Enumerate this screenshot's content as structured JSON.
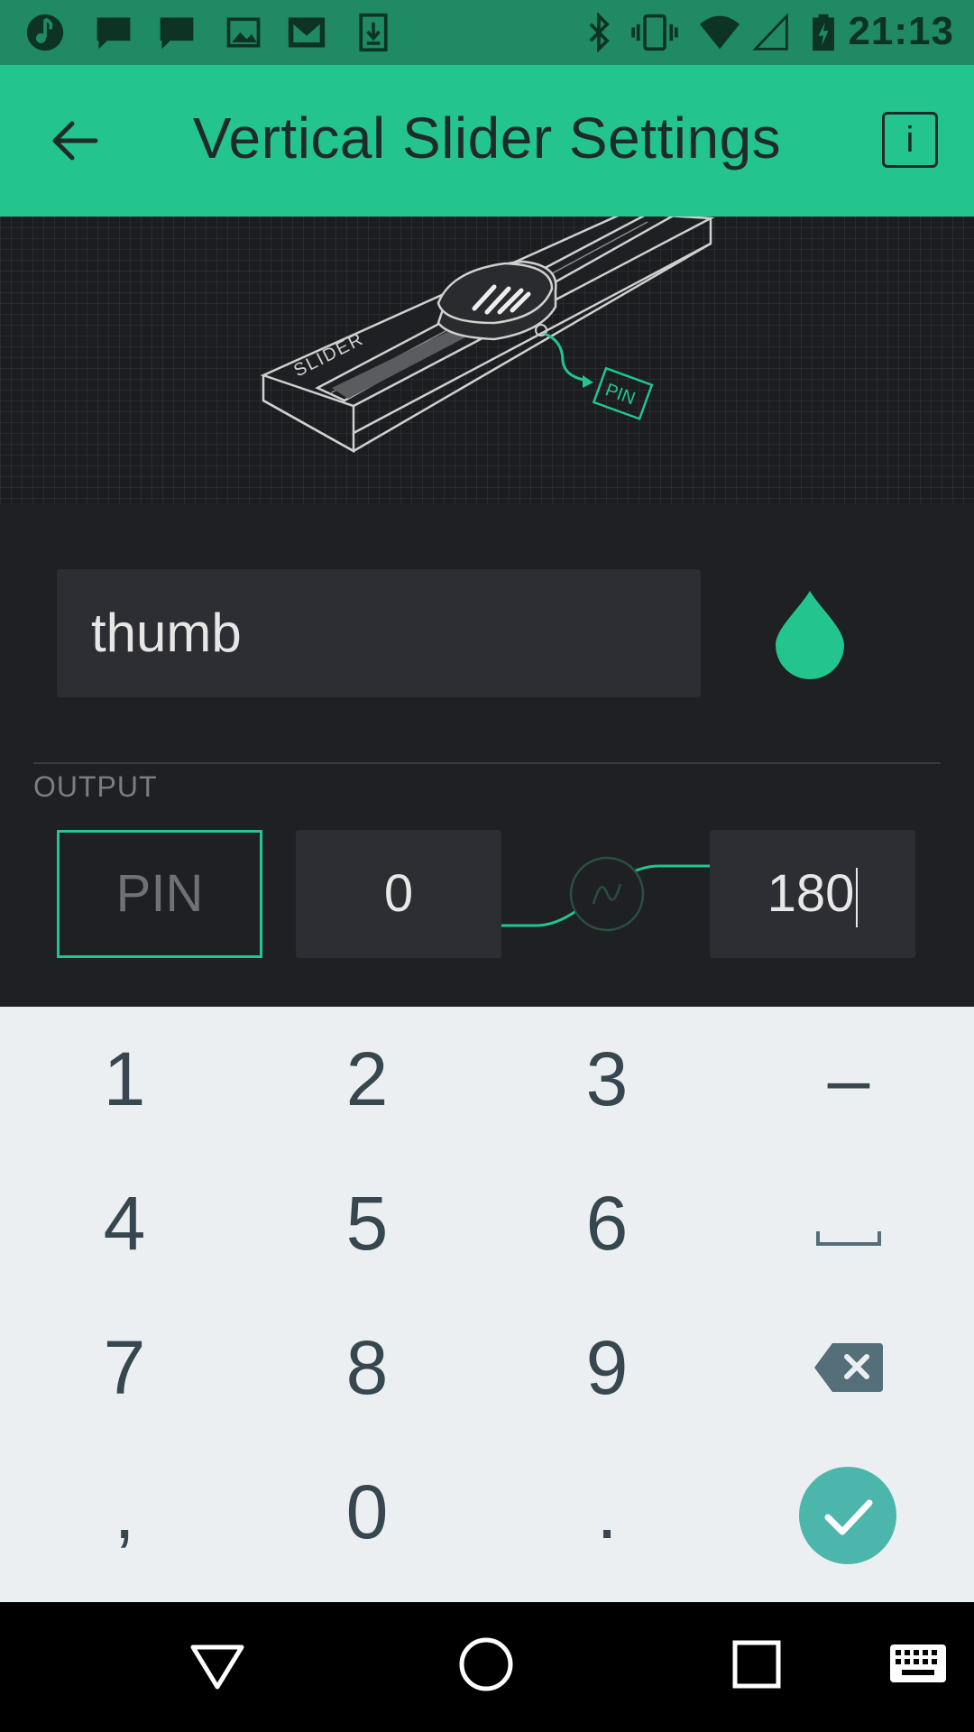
{
  "status_bar": {
    "time": "21:13",
    "left_icons": [
      "app-notification-icon",
      "chat-icon",
      "chat-icon",
      "image-icon",
      "gmail-icon",
      "download-icon"
    ],
    "right_icons": [
      "bluetooth-icon",
      "vibrate-icon",
      "wifi-icon",
      "cell-signal-icon",
      "battery-charging-icon"
    ]
  },
  "app_bar": {
    "title": "Vertical Slider Settings",
    "back_icon": "arrow-left-icon",
    "info_label": "i"
  },
  "illustration": {
    "slider_label": "SLIDER",
    "pin_label": "PIN"
  },
  "form": {
    "name_value": "thumb",
    "color": "#23c48e",
    "output_label": "OUTPUT",
    "pin_label": "PIN",
    "min_value": "0",
    "max_value": "180"
  },
  "keyboard": {
    "rows": [
      [
        "1",
        "2",
        "3",
        "–"
      ],
      [
        "4",
        "5",
        "6",
        "space"
      ],
      [
        "7",
        "8",
        "9",
        "backspace"
      ],
      [
        ",",
        "0",
        ".",
        "enter"
      ]
    ],
    "enter_color": "#4db6ac"
  },
  "nav_bar": {
    "buttons": [
      "back-triangle-icon",
      "home-circle-icon",
      "recents-square-icon",
      "keyboard-icon"
    ]
  },
  "colors": {
    "accent": "#23c48e",
    "status_bar": "#1f8a63",
    "background": "#1f2023",
    "field": "#2d2e33",
    "keyboard": "#eceff1"
  }
}
